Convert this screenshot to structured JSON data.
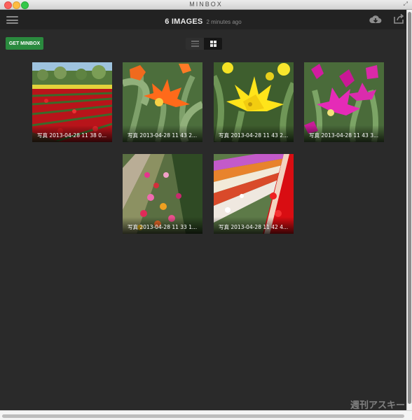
{
  "window": {
    "title": "MINBOX"
  },
  "header": {
    "count_label": "6 IMAGES",
    "updated": "2 minutes ago"
  },
  "toolbar": {
    "get_button_label": "GET MINBOX"
  },
  "view": {
    "modes": [
      "list",
      "grid"
    ],
    "active": "grid"
  },
  "images": [
    {
      "caption": "写真 2013-04-28 11 38 0..."
    },
    {
      "caption": "写真 2013-04-28 11 43 2..."
    },
    {
      "caption": "写真 2013-04-28 11 43 2..."
    },
    {
      "caption": "写真 2013-04-28 11 43 3..."
    },
    {
      "caption": "写真 2013-04-28 11 33 1..."
    },
    {
      "caption": "写真 2013-04-28 11 42 4..."
    }
  ],
  "watermark": "週刊アスキー",
  "colors": {
    "background": "#2a2a2a",
    "toolbar": "#222222",
    "accent": "#2a8a3e"
  },
  "icons": [
    "menu-icon",
    "cloud-download-icon",
    "share-icon",
    "list-view-icon",
    "grid-view-icon"
  ]
}
